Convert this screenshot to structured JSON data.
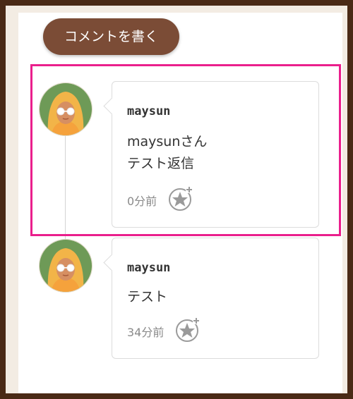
{
  "write_button": {
    "label": "コメントを書く"
  },
  "comments": [
    {
      "author": "maysun",
      "lines": [
        "maysunさん",
        "テスト返信"
      ],
      "time": "0分前",
      "avatar_icon": "avatar-woman-blonde-sunglasses",
      "action_icon": "add-star-icon",
      "highlighted": true
    },
    {
      "author": "maysun",
      "lines": [
        "テスト"
      ],
      "time": "34分前",
      "avatar_icon": "avatar-woman-blonde-sunglasses",
      "action_icon": "add-star-icon",
      "highlighted": false
    }
  ],
  "colors": {
    "frame": "#4a2a16",
    "button": "#7b4c36",
    "highlight": "#ea1f8c",
    "meta_text": "#8a8a8a"
  }
}
